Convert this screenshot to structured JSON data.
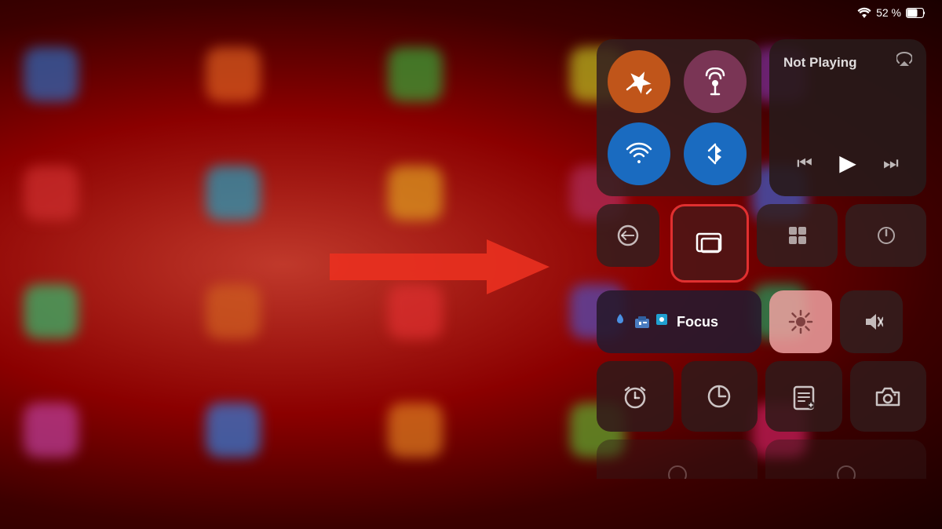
{
  "status_bar": {
    "wifi": "52",
    "battery_label": "52 %"
  },
  "media": {
    "not_playing": "Not Playing"
  },
  "focus": {
    "label": "Focus"
  },
  "buttons": {
    "airplane_mode": "Airplane Mode",
    "hotspot": "Personal Hotspot",
    "wifi": "Wi-Fi",
    "bluetooth": "Bluetooth",
    "screen_mirror": "Screen Mirror",
    "brightness": "Brightness",
    "mute": "Mute",
    "alarm": "Alarm",
    "screen_time": "Screen Time",
    "note_widget": "Note Widget",
    "camera": "Camera",
    "rewind": "Rewind",
    "play": "Play",
    "fast_forward": "Fast Forward"
  },
  "colors": {
    "bg_dark": "#3d0000",
    "panel": "rgba(50,30,30,0.85)",
    "orange": "#c0551a",
    "mauve": "#7a3555",
    "blue": "#1a6bc0",
    "mirror_border": "#e03030",
    "focus_bg": "rgba(40,25,45,0.9)",
    "brightness_bg": "#f0a0a0"
  }
}
